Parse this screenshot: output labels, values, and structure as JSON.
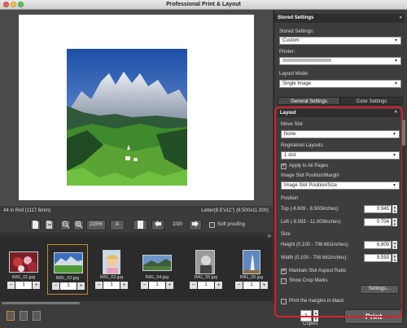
{
  "window": {
    "title": "Professional Print & Layout"
  },
  "preview": {
    "roll_label": "44 in Roll (1117.6mm)",
    "paper_label": "Letter(8.5\"x11\") (8.500x11.000)"
  },
  "toolbar": {
    "zoom": "215%",
    "text_tool": "A",
    "page_counter": "2/20",
    "soft_proofing_label": "Soft proofing"
  },
  "thumbnails": [
    {
      "name": "IMG_01.jpg",
      "count": "1",
      "selected": false
    },
    {
      "name": "IMG_02.jpg",
      "count": "1",
      "selected": true
    },
    {
      "name": "IMG_03.jpg",
      "count": "1",
      "selected": false
    },
    {
      "name": "IMG_04.jpg",
      "count": "1",
      "selected": false
    },
    {
      "name": "IMG_05.jpg",
      "count": "1",
      "selected": false
    },
    {
      "name": "IMG_06.jpg",
      "count": "1",
      "selected": false
    }
  ],
  "bottom": {
    "copies_value": "1",
    "copies_label": "Copies",
    "print_label": "Print"
  },
  "panel": {
    "stored_header": "Stored Settings",
    "stored_label": "Stored Settings:",
    "stored_value": "Custom",
    "printer_label": "Printer:",
    "printer_value": "",
    "layout_mode_label": "Layout Mode:",
    "layout_mode_value": "Single Image",
    "tab_general": "General Settings",
    "tab_color": "Color Settings",
    "layout_header": "Layout",
    "move_slot_label": "Move Slot",
    "move_slot_value": "None",
    "registered_layouts_label": "Registered Layouts",
    "registered_layouts_value": "1 slot",
    "apply_all_label": "Apply to All Pages",
    "apply_all_checked": true,
    "slot_position_label": "Image Slot Position/Margin",
    "slot_position_value": "Image Slot Position/Size",
    "position_label": "Position",
    "top_label": "Top (-6.609 - 8.500inches):",
    "top_value": "0.945",
    "left_label": "Left (-9.593 - 11.000inches):",
    "left_value": "0.704",
    "size_label": "Size",
    "height_label": "Height (0.100 - 708.661inches):",
    "height_value": "6.609",
    "width_label": "Width (0.100 - 708.661inches):",
    "width_value": "9.593",
    "maintain_ratio_label": "Maintain Slot Aspect Ratio",
    "maintain_ratio_checked": true,
    "show_crop_label": "Show Crop Marks",
    "show_crop_checked": false,
    "settings_button": "Settings...",
    "margins_black_label": "Print the margins in black",
    "margins_black_checked": false
  }
}
